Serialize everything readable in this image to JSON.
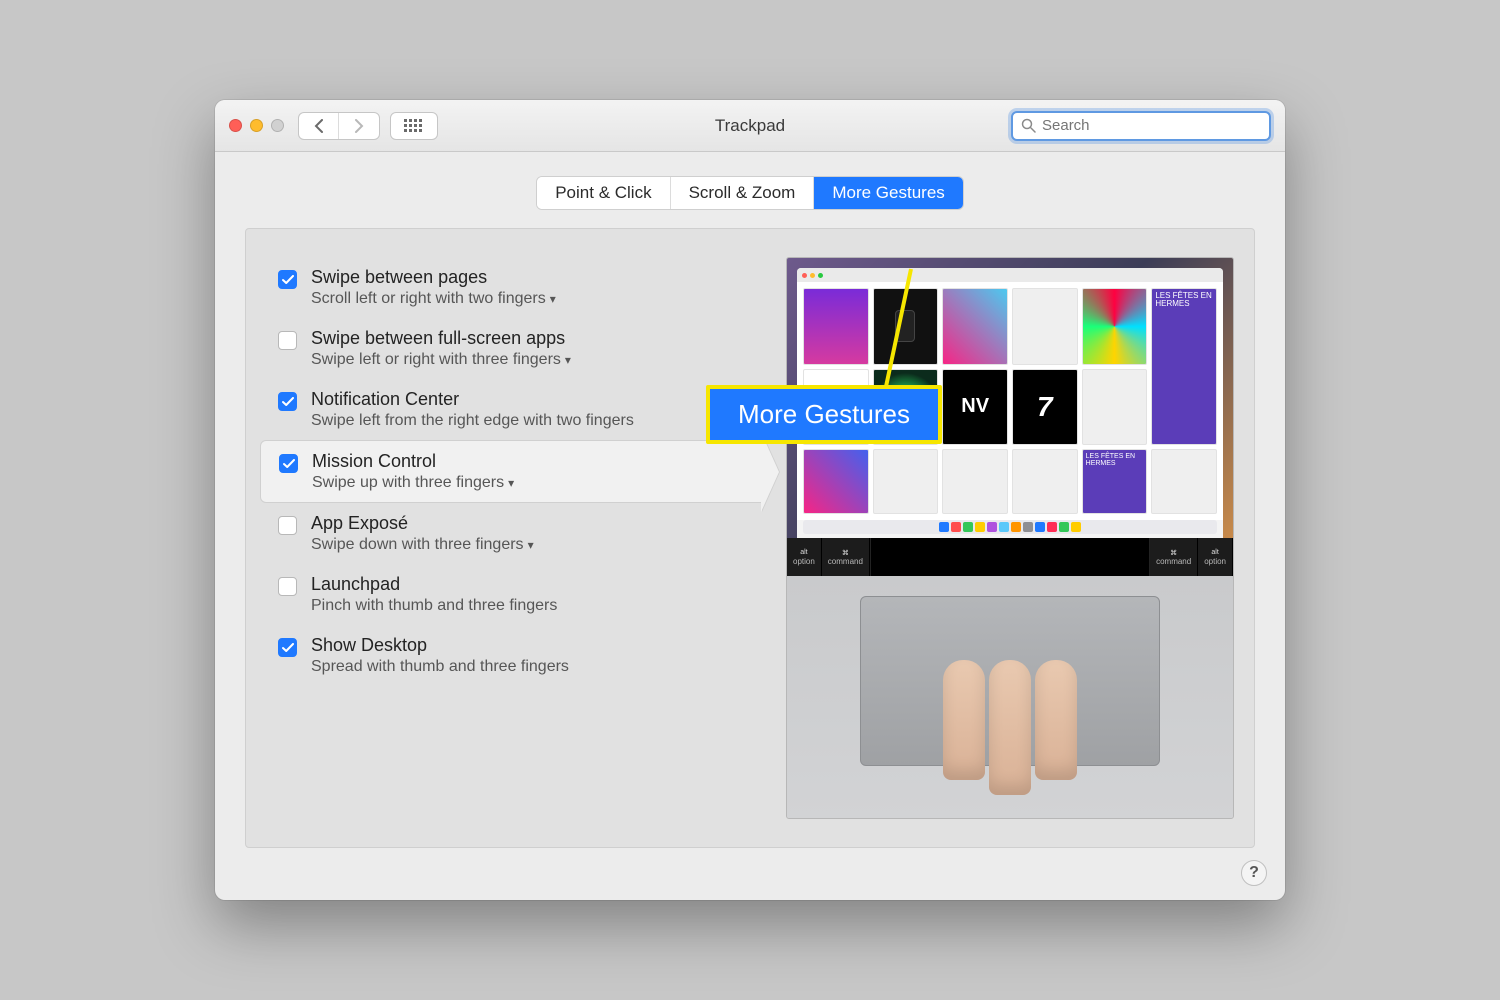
{
  "window": {
    "title": "Trackpad"
  },
  "search": {
    "placeholder": "Search"
  },
  "tabs": {
    "point_click": "Point & Click",
    "scroll_zoom": "Scroll & Zoom",
    "more_gestures": "More Gestures",
    "selected": "more_gestures"
  },
  "callout": {
    "label": "More Gestures"
  },
  "gestures": [
    {
      "title": "Swipe between pages",
      "subtitle": "Scroll left or right with two fingers",
      "checked": true,
      "dropdown": true
    },
    {
      "title": "Swipe between full-screen apps",
      "subtitle": "Swipe left or right with three fingers",
      "checked": false,
      "dropdown": true
    },
    {
      "title": "Notification Center",
      "subtitle": "Swipe left from the right edge with two fingers",
      "checked": true,
      "dropdown": false
    },
    {
      "title": "Mission Control",
      "subtitle": "Swipe up with three fingers",
      "checked": true,
      "dropdown": true,
      "selected": true
    },
    {
      "title": "App Exposé",
      "subtitle": "Swipe down with three fingers",
      "checked": false,
      "dropdown": true
    },
    {
      "title": "Launchpad",
      "subtitle": "Pinch with thumb and three fingers",
      "checked": false,
      "dropdown": false
    },
    {
      "title": "Show Desktop",
      "subtitle": "Spread with thumb and three fingers",
      "checked": true,
      "dropdown": false
    }
  ],
  "help": {
    "label": "?"
  },
  "preview": {
    "hermes_text": "LES FÊTES EN HERMES",
    "seven": "7",
    "nv": "NV"
  }
}
